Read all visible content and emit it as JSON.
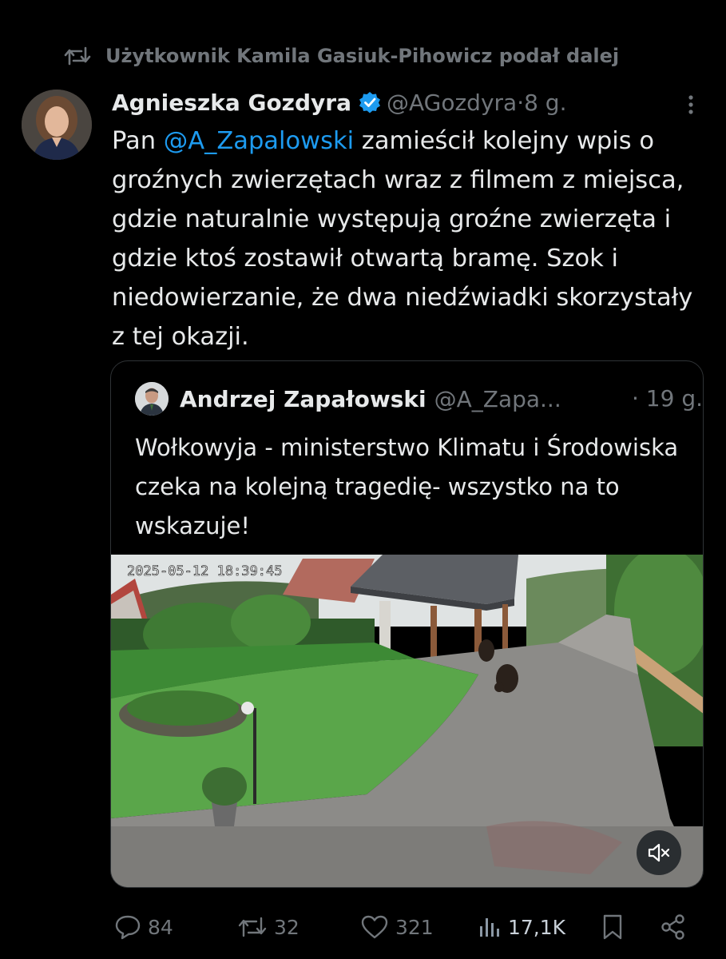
{
  "retweet_header": {
    "text": "Użytkownik Kamila Gasiuk-Pihowicz podał dalej",
    "icon": "retweet-icon"
  },
  "tweet": {
    "author_name": "Agnieszka Gozdyra",
    "verified_icon": "verified-badge-icon",
    "handle": "@AGozdyra",
    "separator": " · ",
    "time": "8 g.",
    "text_prefix": "Pan ",
    "mention": "@A_Zapalowski",
    "text_rest": " zamieścił kolejny wpis o groźnych zwierzętach wraz z filmem z miejsca, gdzie naturalnie występują groźne zwierzęta i gdzie ktoś zostawił otwartą bramę. Szok i niedowierzanie, że dwa niedźwiadki skorzystały z tej okazji."
  },
  "quoted_tweet": {
    "author_name": "Andrzej Zapałowski",
    "handle": "@A_Zapa...",
    "time": "· 19 g.",
    "text": "Wołkowyja - ministerstwo Klimatu i Środowiska czeka na kolejną tragedię- wszystko na to wskazuje!",
    "video": {
      "timestamp_overlay": "2025-05-12 18:39:45",
      "mute_icon": "volume-muted-icon"
    }
  },
  "actions": {
    "replies": "84",
    "reposts": "32",
    "likes": "321",
    "views": "17,1K",
    "icons": [
      "reply-icon",
      "retweet-icon",
      "heart-icon",
      "views-icon",
      "bookmark-icon",
      "share-icon"
    ]
  },
  "colors": {
    "background": "#000000",
    "text": "#e7e9ea",
    "secondary": "#71767b",
    "accent": "#1d9bf0",
    "border": "#2f3336"
  }
}
